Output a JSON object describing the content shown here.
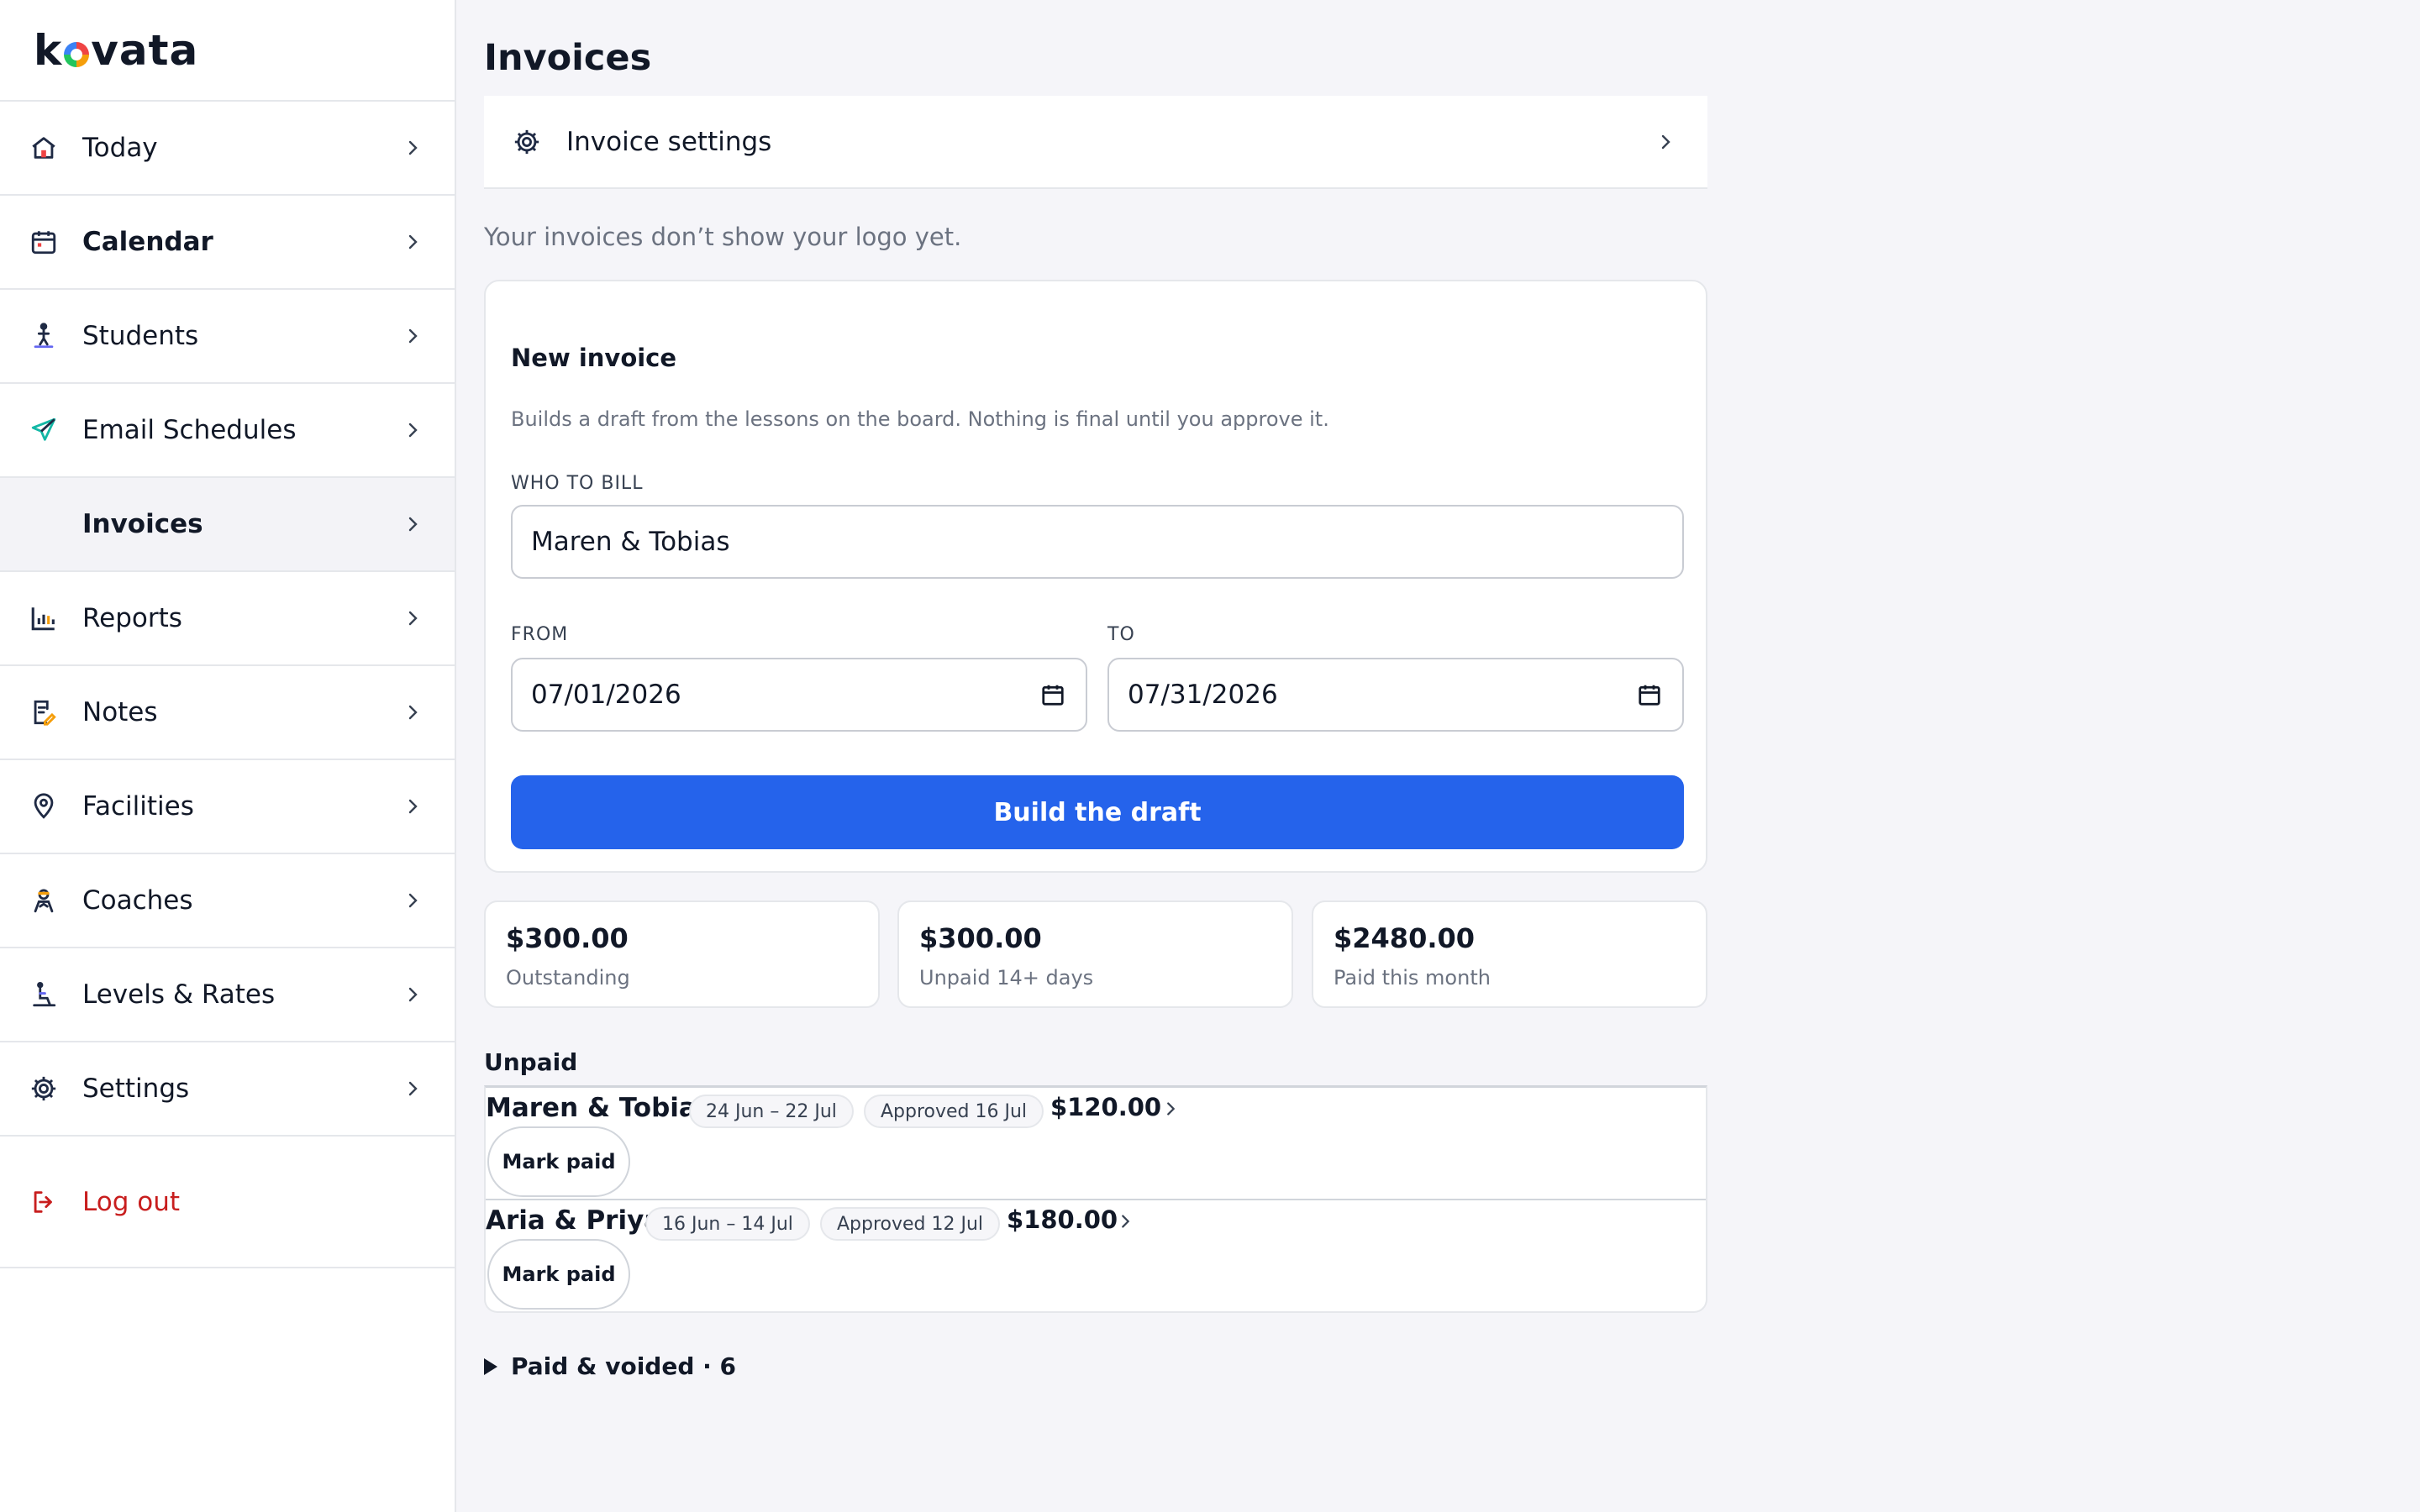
{
  "brand": {
    "name_pre": "k",
    "name_post": "vata"
  },
  "sidebar": {
    "items": [
      {
        "label": "Today",
        "icon": "home-icon",
        "bold": false
      },
      {
        "label": "Calendar",
        "icon": "calendar-icon",
        "bold": true
      },
      {
        "label": "Students",
        "icon": "student-icon",
        "bold": false
      },
      {
        "label": "Email Schedules",
        "icon": "paper-plane-icon",
        "bold": false
      },
      {
        "label": "Invoices",
        "icon": "none",
        "bold": true,
        "active": true
      },
      {
        "label": "Reports",
        "icon": "bar-chart-icon",
        "bold": false
      },
      {
        "label": "Notes",
        "icon": "notes-icon",
        "bold": false
      },
      {
        "label": "Facilities",
        "icon": "location-pin-icon",
        "bold": false
      },
      {
        "label": "Coaches",
        "icon": "coach-icon",
        "bold": false
      },
      {
        "label": "Levels & Rates",
        "icon": "levels-icon",
        "bold": false
      },
      {
        "label": "Settings",
        "icon": "gear-icon",
        "bold": false
      }
    ],
    "logout_label": "Log out"
  },
  "page": {
    "title": "Invoices",
    "settings_label": "Invoice settings",
    "logo_hint": "Your invoices don’t show your logo yet."
  },
  "new_invoice": {
    "title": "New invoice",
    "description": "Builds a draft from the lessons on the board. Nothing is final until you approve it.",
    "who_label": "WHO TO BILL",
    "who_value": "Maren & Tobias",
    "from_label": "FROM",
    "from_value": "07/01/2026",
    "to_label": "TO",
    "to_value": "07/31/2026",
    "build_label": "Build the draft"
  },
  "stats": [
    {
      "value": "$300.00",
      "caption": "Outstanding"
    },
    {
      "value": "$300.00",
      "caption": "Unpaid 14+ days"
    },
    {
      "value": "$2480.00",
      "caption": "Paid this month"
    }
  ],
  "unpaid": {
    "title": "Unpaid",
    "rows": [
      {
        "name": "Maren & Tobias",
        "range": "24 Jun – 22 Jul",
        "approved": "Approved 16 Jul",
        "amount": "$120.00",
        "action": "Mark paid"
      },
      {
        "name": "Aria & Priya",
        "range": "16 Jun – 14 Jul",
        "approved": "Approved 12 Jul",
        "amount": "$180.00",
        "action": "Mark paid"
      }
    ]
  },
  "paid_voided_label": "Paid & voided · 6",
  "colors": {
    "accent": "#2563eb",
    "logout": "#c81e1e"
  }
}
